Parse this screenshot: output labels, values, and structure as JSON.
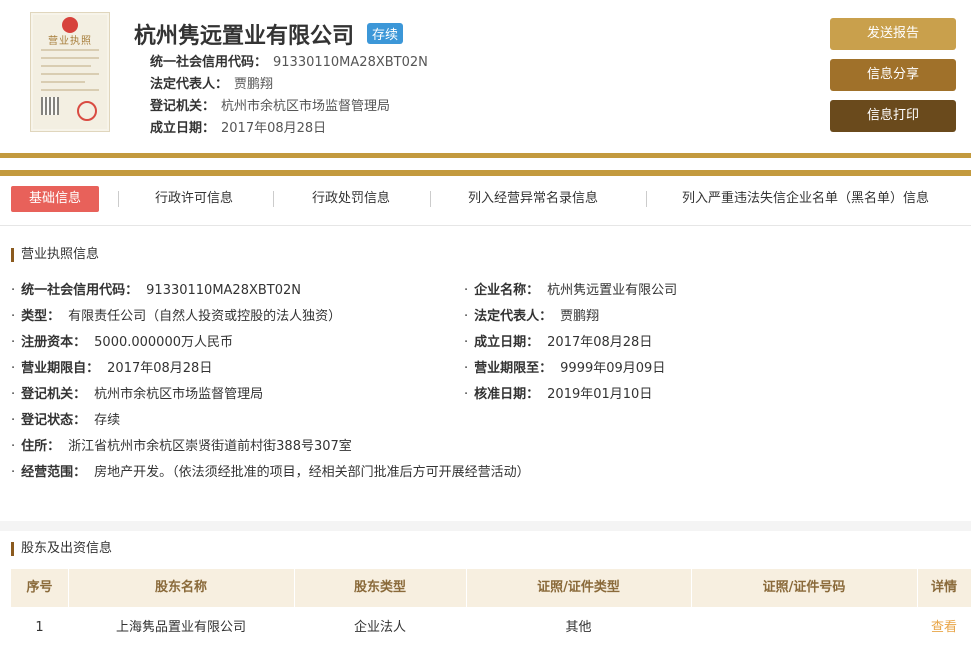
{
  "company": {
    "name": "杭州隽远置业有限公司",
    "status": "存续",
    "credit_code_label": "统一社会信用代码：",
    "credit_code": "91330110MA28XBT02N",
    "legal_rep_label": "法定代表人：",
    "legal_rep": "贾鹏翔",
    "authority_label": "登记机关：",
    "authority": "杭州市余杭区市场监督管理局",
    "established_label": "成立日期：",
    "established": "2017年08月28日"
  },
  "license_image": {
    "title": "营业执照"
  },
  "buttons": {
    "send": "发送报告",
    "share": "信息分享",
    "print": "信息打印"
  },
  "tabs": [
    "基础信息",
    "行政许可信息",
    "行政处罚信息",
    "列入经营异常名录信息",
    "列入严重违法失信企业名单（黑名单）信息"
  ],
  "license_section": {
    "title": "营业执照信息",
    "left": [
      {
        "label": "统一社会信用代码：",
        "value": "91330110MA28XBT02N"
      },
      {
        "label": "类型：",
        "value": "有限责任公司（自然人投资或控股的法人独资）"
      },
      {
        "label": "注册资本：",
        "value": "5000.000000万人民币"
      },
      {
        "label": "营业期限自：",
        "value": "2017年08月28日"
      },
      {
        "label": "登记机关：",
        "value": "杭州市余杭区市场监督管理局"
      },
      {
        "label": "登记状态：",
        "value": "存续"
      },
      {
        "label": "住所：",
        "value": "浙江省杭州市余杭区崇贤街道前村街388号307室"
      },
      {
        "label": "经营范围：",
        "value": "房地产开发。（依法须经批准的项目，经相关部门批准后方可开展经营活动）"
      }
    ],
    "right": [
      {
        "label": "企业名称：",
        "value": "杭州隽远置业有限公司"
      },
      {
        "label": "法定代表人：",
        "value": "贾鹏翔"
      },
      {
        "label": "成立日期：",
        "value": "2017年08月28日"
      },
      {
        "label": "营业期限至：",
        "value": "9999年09月09日"
      },
      {
        "label": "核准日期：",
        "value": "2019年01月10日"
      }
    ]
  },
  "shareholder_section": {
    "title": "股东及出资信息",
    "headers": [
      "序号",
      "股东名称",
      "股东类型",
      "证照/证件类型",
      "证照/证件号码",
      "详情"
    ],
    "rows": [
      [
        "1",
        "上海隽品置业有限公司",
        "企业法人",
        "其他",
        "",
        "查看"
      ]
    ]
  },
  "colors": {
    "gold": "#c39a3e",
    "active_tab": "#e8615a",
    "badge": "#3c97d8"
  }
}
